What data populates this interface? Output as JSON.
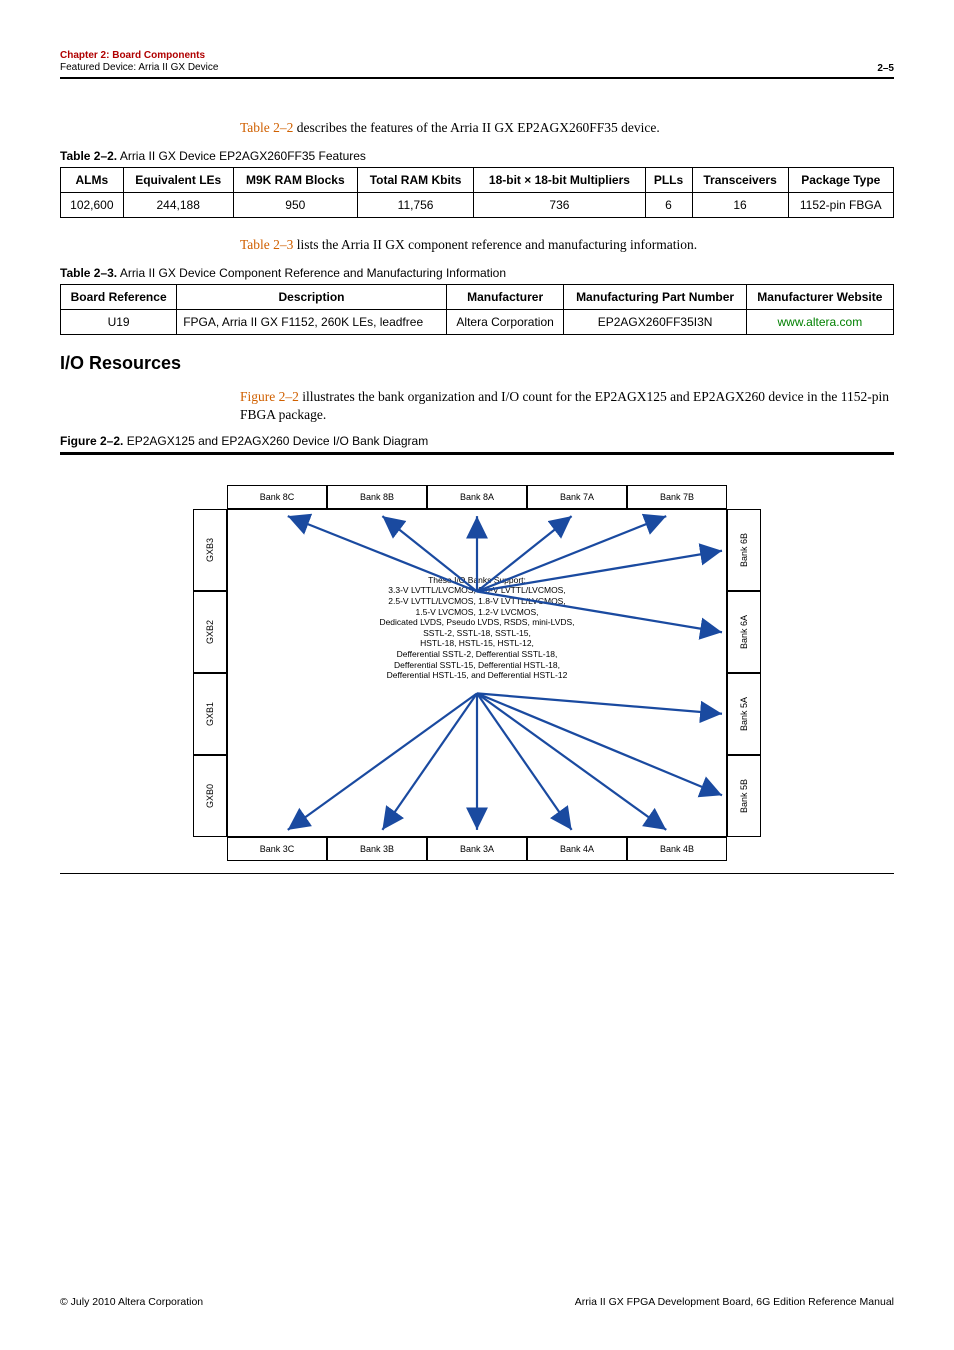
{
  "header": {
    "chapter": "Chapter 2: Board Components",
    "section": "Featured Device: Arria II GX Device",
    "page_num": "2–5"
  },
  "para1_pre": "Table 2–2",
  "para1_post": " describes the features of the Arria II GX EP2AGX260FF35 device.",
  "table22": {
    "caption_num": "Table 2–2.",
    "caption_txt": "  Arria II GX Device EP2AGX260FF35 Features",
    "head": [
      "ALMs",
      "Equivalent LEs",
      "M9K RAM Blocks",
      "Total RAM Kbits",
      "18-bit × 18-bit Multipliers",
      "PLLs",
      "Transceivers",
      "Package Type"
    ],
    "row": [
      "102,600",
      "244,188",
      "950",
      "11,756",
      "736",
      "6",
      "16",
      "1152-pin FBGA"
    ]
  },
  "para2_pre": "Table 2–3",
  "para2_post": " lists the Arria II GX component reference and manufacturing information.",
  "table23": {
    "caption_num": "Table 2–3.",
    "caption_txt": "  Arria II GX Device Component Reference and Manufacturing Information",
    "head": [
      "Board Reference",
      "Description",
      "Manufacturer",
      "Manufacturing Part Number",
      "Manufacturer Website"
    ],
    "row": [
      "U19",
      "FPGA, Arria II GX F1152, 260K LEs, leadfree",
      "Altera Corporation",
      "EP2AGX260FF35I3N",
      "www.altera.com"
    ]
  },
  "section_title": "I/O Resources",
  "para3_pre": "Figure 2–2",
  "para3_post": " illustrates the bank organization and I/O count for the EP2AGX125 and EP2AGX260 device in the 1152-pin FBGA package.",
  "fig_caption_num": "Figure 2–2.",
  "fig_caption_txt": "  EP2AGX125 and EP2AGX260 Device I/O Bank Diagram",
  "diagram": {
    "top": [
      "Bank 8C",
      "Bank 8B",
      "Bank 8A",
      "Bank 7A",
      "Bank 7B"
    ],
    "left": [
      "GXB3",
      "GXB2",
      "GXB1",
      "GXB0"
    ],
    "right": [
      "Bank 6B",
      "Bank 6A",
      "Bank 5A",
      "Bank 5B"
    ],
    "bottom": [
      "Bank 3C",
      "Bank 3B",
      "Bank 3A",
      "Bank 4A",
      "Bank 4B"
    ],
    "center_title": "These I/O Banks Support:",
    "center_l1": "3.3-V LVTTL/LVCMOS, 3.0-V LVTTL/LVCMOS,",
    "center_l2": "2.5-V LVTTL/LVCMOS, 1.8-V LVTTL/LVCMOS,",
    "center_l3": "1.5-V LVCMOS, 1.2-V LVCMOS,",
    "center_l4": "Dedicated LVDS, Pseudo LVDS, RSDS, mini-LVDS,",
    "center_l5": "SSTL-2, SSTL-18, SSTL-15,",
    "center_l6": "HSTL-18, HSTL-15, HSTL-12,",
    "center_l7": "Defferential SSTL-2, Defferential SSTL-18,",
    "center_l8": "Defferential SSTL-15, Defferential HSTL-18,",
    "center_l9": "Defferential HSTL-15, and Defferential HSTL-12"
  },
  "footer": {
    "left": "© July 2010   Altera Corporation",
    "right": "Arria II GX FPGA Development Board, 6G Edition Reference Manual"
  }
}
